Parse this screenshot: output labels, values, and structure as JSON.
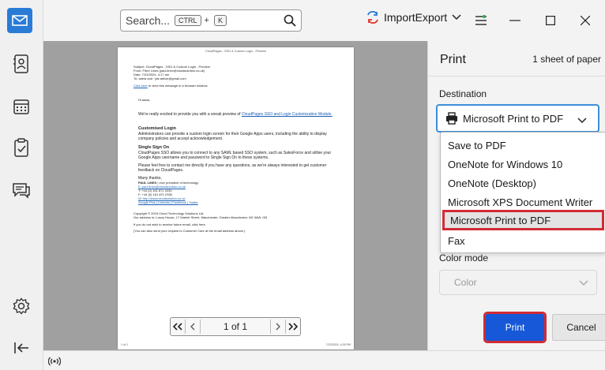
{
  "search": {
    "placeholder": "Search...",
    "key1": "CTRL",
    "plus": "+",
    "key2": "K"
  },
  "toolbar": {
    "import_export_label": "ImportExport"
  },
  "rail": {
    "icons": [
      "mail-icon",
      "contacts-icon",
      "calendar-icon",
      "tasks-icon",
      "chat-icon",
      "settings-icon",
      "collapse-icon"
    ]
  },
  "document": {
    "header": "CloudPages - SSO & Custom Login - Preview",
    "subject": "Subject: CloudPages - SSO & Custom Login - Preview",
    "from": "From: Fibre Lines (paul.linex@cloudsolution.co.uk)",
    "date": "Date: 7/23/2024, 4:17 am",
    "to": "To: adela and ~jair.article@gmail.com",
    "click_here": "Click here",
    "click_rest": " to view this message in a browser window.",
    "greeting": "Hi aaaa,",
    "intro": "We're really excited to provide you with a sneak preview of ",
    "intro_link": "CloudPages SSO and Login Customization Module.",
    "h_custom": "Customised Login",
    "p_custom": "Administrators can provide a custom login screen for their Google Apps users, including the ability to display company policies and accept acknowledgement.",
    "h_sso": "Single Sign On",
    "p_sso": "CloudPages SSO allows you to connect to any SAML based SSO system, such as SalesForce and utilise your Google Apps username and password to Single Sign On to these systems.",
    "p_contact": "Please feel free to contact me directly if you have any questions, as we're always interested to get customer feedback on CloudPages.",
    "thanks": "Many thanks,",
    "sig_name": "PAUL LINEX",
    "sig_rest": " | vice president of technology",
    "sig_email": "E: paul.linex@cloudsolution.co.uk",
    "sig_t": "T: +44 (0) 161 871 0330",
    "sig_f": "F: +44 (0) 161 871 0330",
    "sig_web": "W: http://www.cloudsolution.co.uk",
    "sig_social": "Google Plus | Linkedin | Facebook | Twitter",
    "copyright": "Copyright © 2015 Cloud Technology Solutions Ltd.",
    "address": "Our address is: Lowry House, 17 Marble Street, Manchester, Greater Manchester, M2 3AW, GB",
    "unsub": "If you do not wish to receive future email, click here.",
    "footer_line": "(You can also send your request to Customer Care at the email address above.)",
    "page_footer_left": "1 of 1",
    "page_footer_right": "7/23/2024, 4:26 PM"
  },
  "pager": {
    "text": "1 of 1"
  },
  "print_panel": {
    "title": "Print",
    "sheets": "1 sheet of paper",
    "destination_label": "Destination",
    "destination_value": "Microsoft Print to PDF",
    "options": [
      "Save to PDF",
      "OneNote for Windows 10",
      "OneNote (Desktop)",
      "Microsoft XPS Document Writer",
      "Microsoft Print to PDF",
      "Fax"
    ],
    "selected_index": 4,
    "color_mode_label": "Color mode",
    "color_mode_value": "Color",
    "print_label": "Print",
    "cancel_label": "Cancel"
  },
  "colors": {
    "accent": "#1658d8",
    "highlight": "#d22b34",
    "app_icon": "#2a7bd6"
  }
}
